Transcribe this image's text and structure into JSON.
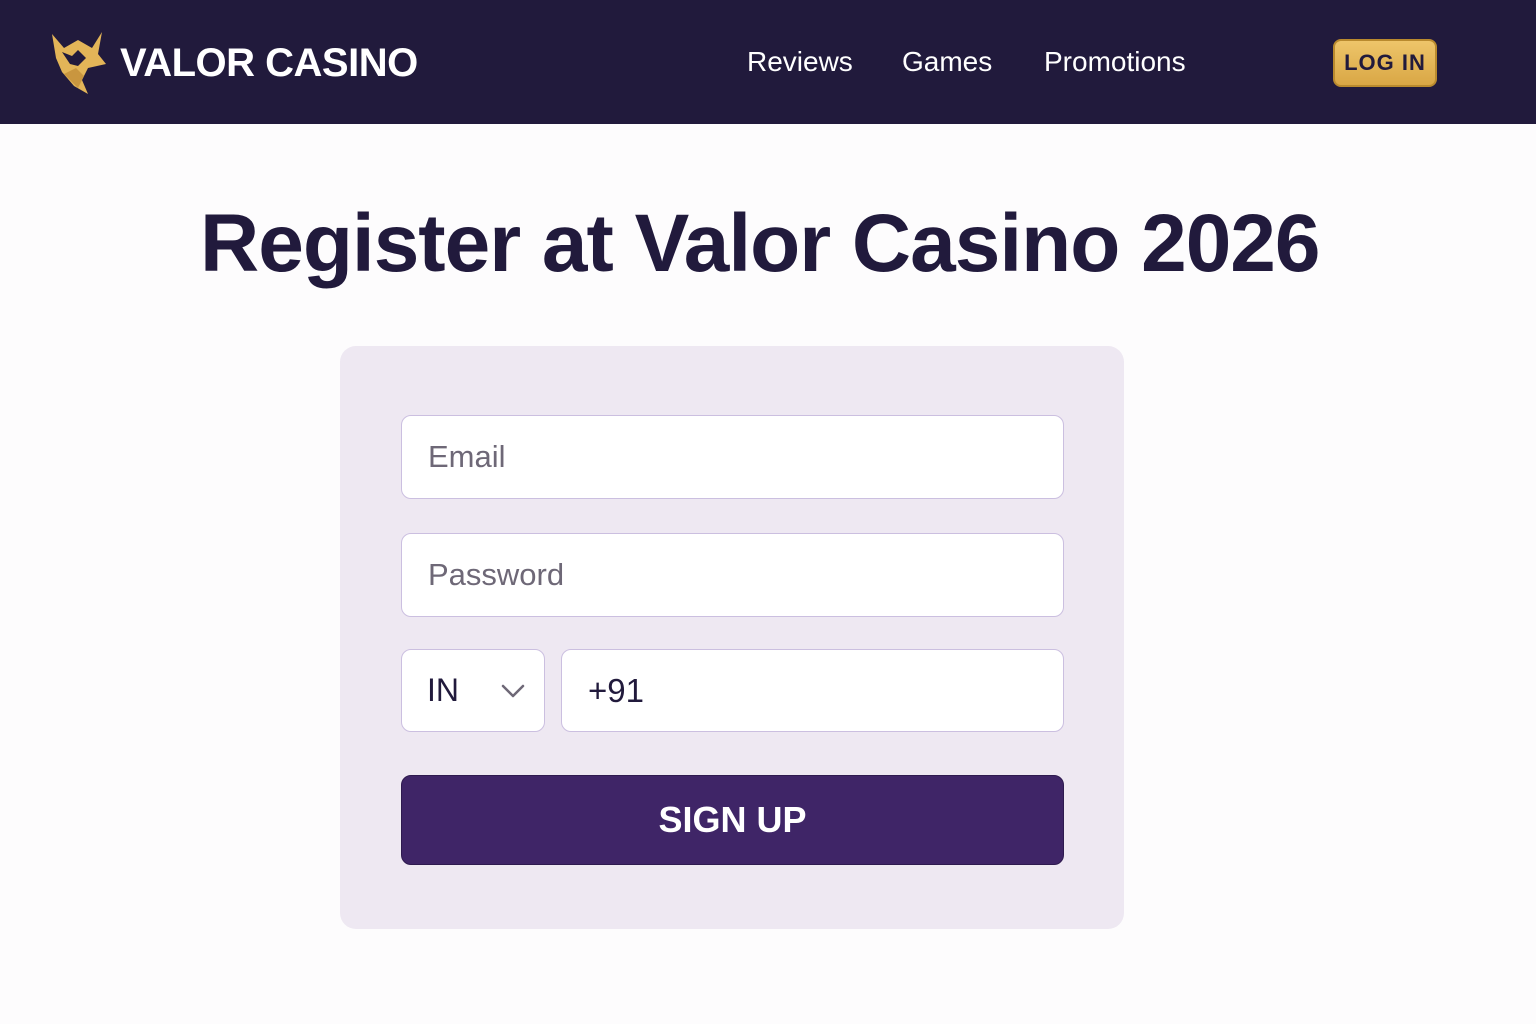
{
  "header": {
    "brand_name": "VALOR CASINO",
    "logo_icon": "fox-head-logo-icon",
    "nav": [
      "Reviews",
      "Games",
      "Promotions"
    ],
    "login_label": "LOG IN"
  },
  "main": {
    "title": "Register at Valor Casino 2026",
    "form": {
      "email_placeholder": "Email",
      "password_placeholder": "Password",
      "country_value": "IN",
      "phone_value": "+91",
      "signup_label": "SIGN UP"
    }
  },
  "colors": {
    "header_bg": "#211a3c",
    "accent_gold": "#e3b558",
    "card_bg": "#eee8f2",
    "button_purple": "#3f2567"
  }
}
